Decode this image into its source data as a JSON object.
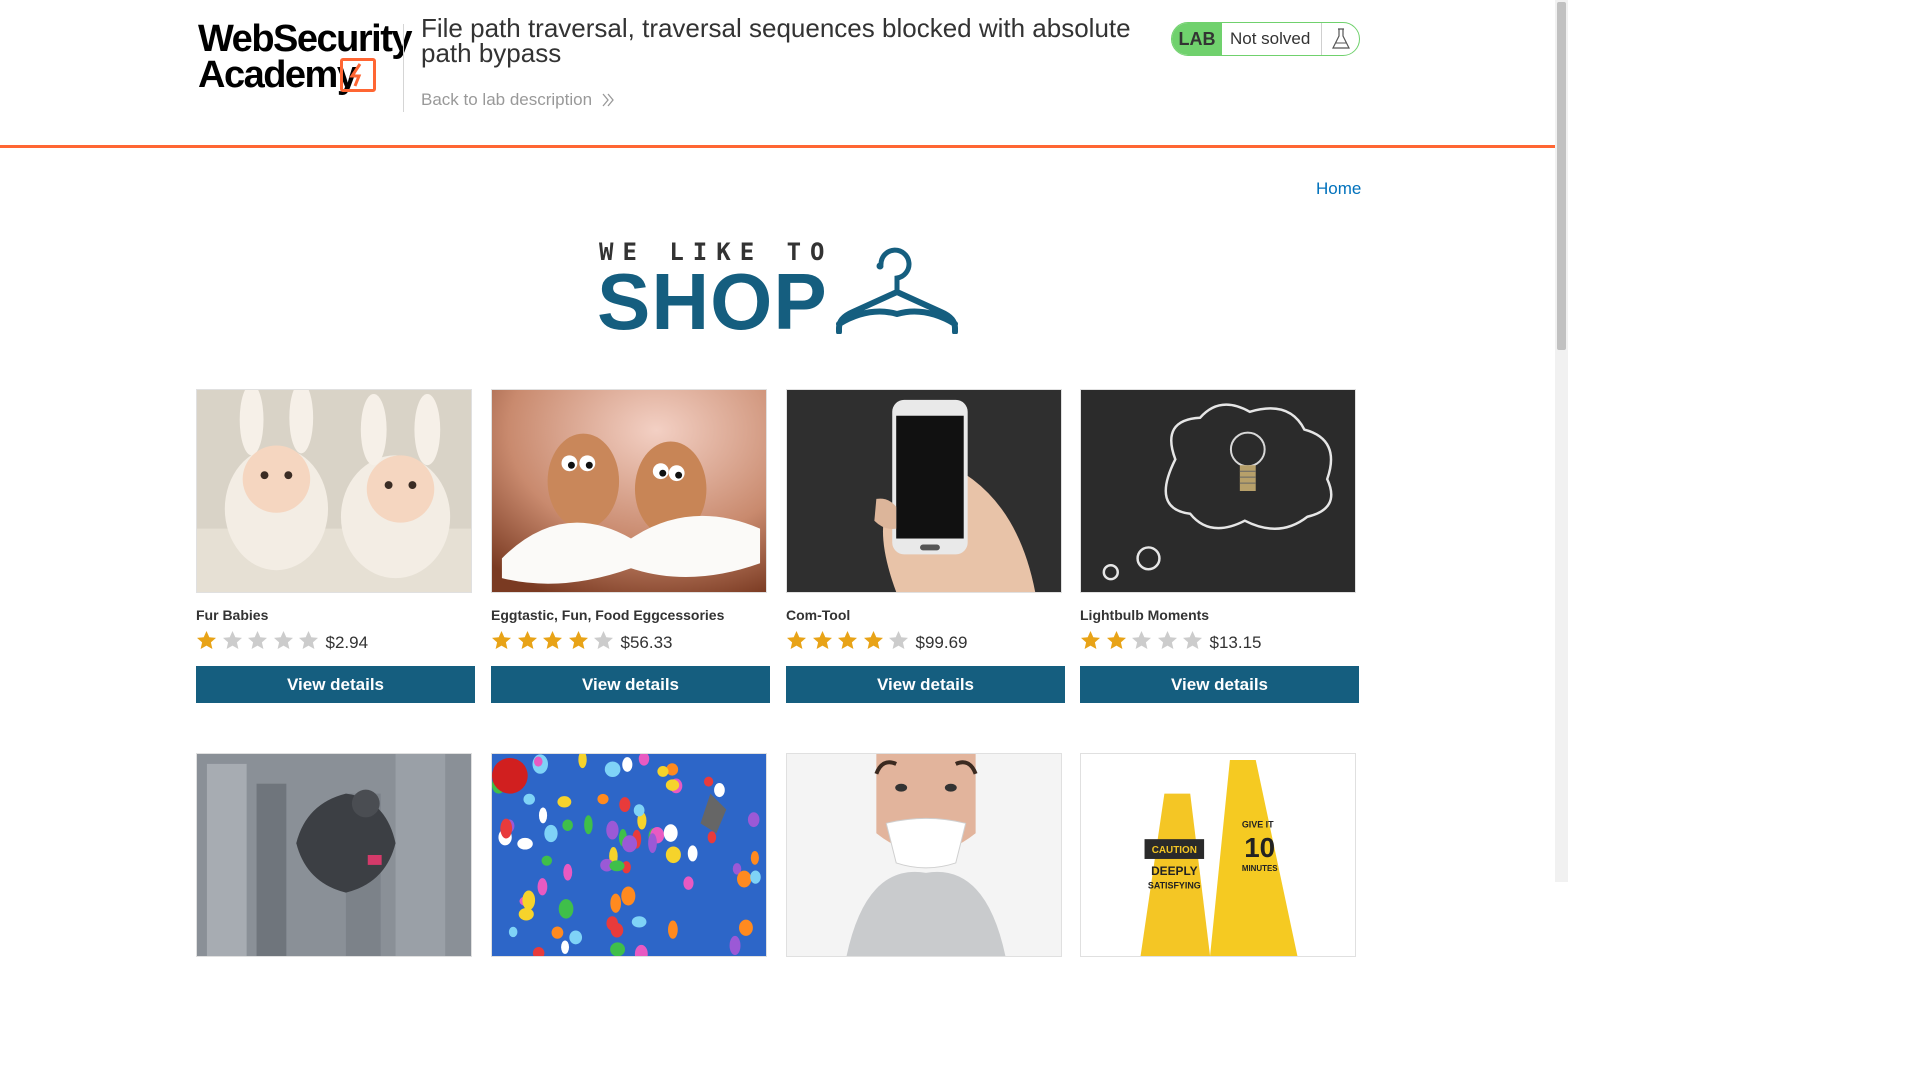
{
  "header": {
    "logo_line1": "WebSecurity",
    "logo_line2": "Academy",
    "lab_title": "File path traversal, traversal sequences blocked with absolute path bypass",
    "back_link": "Back to lab description",
    "lab_badge": "LAB",
    "lab_status": "Not solved"
  },
  "nav": {
    "home": "Home"
  },
  "banner": {
    "tagline": "WE LIKE TO",
    "word": "SHOP",
    "icon": "coat-hanger-icon"
  },
  "colors": {
    "accent": "#ff6633",
    "primary": "#155e7f",
    "link": "#0071bc",
    "lab_green": "#70d16d",
    "star_gold": "#e8a317",
    "star_grey": "#cccccc"
  },
  "products": [
    {
      "name": "Fur Babies",
      "rating": 1,
      "price": "$2.94",
      "button": "View details",
      "image": "babies-in-bunny-hats"
    },
    {
      "name": "Eggtastic, Fun, Food Eggcessories",
      "rating": 4,
      "price": "$56.33",
      "button": "View details",
      "image": "eggs-with-googly-eyes"
    },
    {
      "name": "Com-Tool",
      "rating": 4,
      "price": "$99.69",
      "button": "View details",
      "image": "hand-holding-smartphone"
    },
    {
      "name": "Lightbulb Moments",
      "rating": 2,
      "price": "$13.15",
      "button": "View details",
      "image": "lightbulb-thought-cloud"
    },
    {
      "image": "city-climber"
    },
    {
      "image": "flying-balloons"
    },
    {
      "image": "man-eating-paper"
    },
    {
      "image": "caution-wet-floor-signs"
    }
  ],
  "signs_text": {
    "caution": "CAUTION",
    "deeply": "DEEPLY",
    "satisfying": "SATISFYING",
    "give_it": "GIVE IT",
    "ten": "10",
    "minutes": "MINUTES"
  }
}
